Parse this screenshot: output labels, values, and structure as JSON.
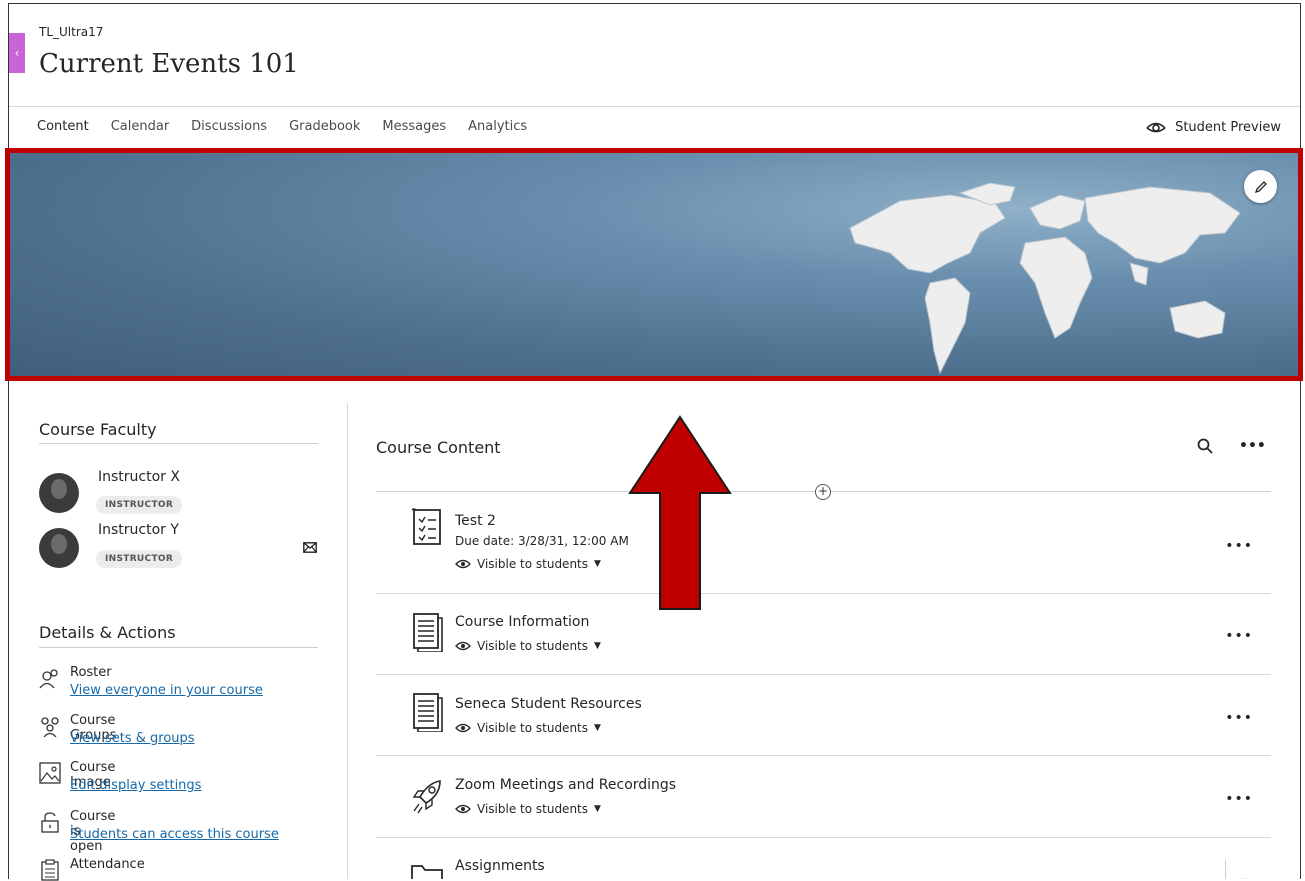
{
  "course": {
    "id": "TL_Ultra17",
    "title": "Current Events 101"
  },
  "nav": {
    "tabs": [
      "Content",
      "Calendar",
      "Discussions",
      "Gradebook",
      "Messages",
      "Analytics"
    ],
    "student_preview": "Student Preview"
  },
  "faculty": {
    "title": "Course Faculty",
    "instructors": [
      {
        "name": "Instructor X",
        "role": "INSTRUCTOR"
      },
      {
        "name": "Instructor Y",
        "role": "INSTRUCTOR"
      }
    ]
  },
  "details": {
    "title": "Details & Actions",
    "items": [
      {
        "label": "Roster",
        "link": "View everyone in your course",
        "icon": "roster-icon"
      },
      {
        "label": "Course Groups",
        "link": "View sets & groups",
        "icon": "groups-icon"
      },
      {
        "label": "Course Image",
        "link": "Edit display settings",
        "icon": "image-icon"
      },
      {
        "label": "Course is open",
        "link": "Students can access this course",
        "icon": "unlock-icon"
      },
      {
        "label": "Attendance",
        "link": "",
        "icon": "attendance-icon"
      }
    ]
  },
  "content": {
    "title": "Course Content",
    "items": [
      {
        "title": "Test 2",
        "due": "Due date: 3/28/31, 12:00 AM",
        "visibility": "Visible to students",
        "icon": "test-icon"
      },
      {
        "title": "Course Information",
        "visibility": "Visible to students",
        "icon": "document-icon"
      },
      {
        "title": "Seneca Student Resources",
        "visibility": "Visible to students",
        "icon": "document-icon"
      },
      {
        "title": "Zoom Meetings and Recordings",
        "visibility": "Visible to students",
        "icon": "rocket-icon"
      },
      {
        "title": "Assignments",
        "icon": "folder-icon"
      }
    ]
  },
  "colors": {
    "highlight_border": "#c00000",
    "arrow": "#c00000",
    "link": "#1769a8",
    "back_tab": "#c964d6"
  }
}
